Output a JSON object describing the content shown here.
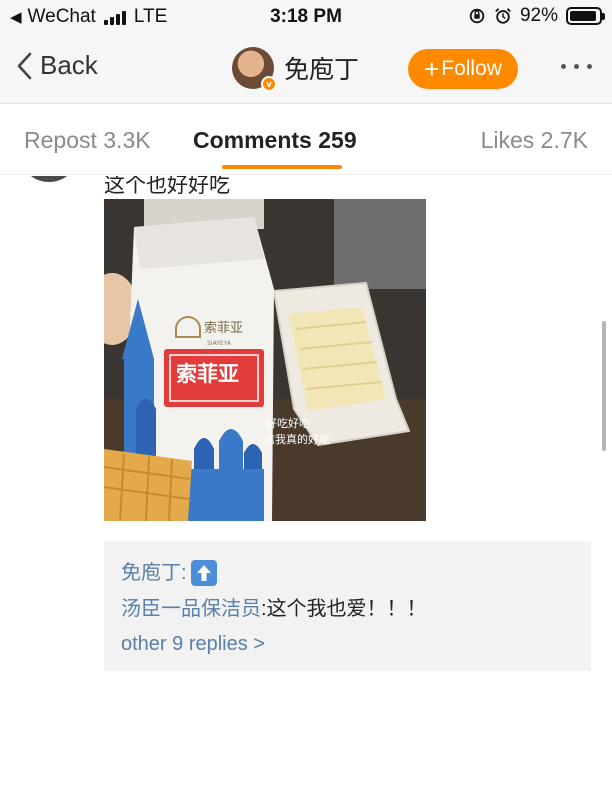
{
  "status_bar": {
    "carrier": "WeChat",
    "network": "LTE",
    "time": "3:18 PM",
    "battery": "92%",
    "battery_level": 0.92
  },
  "nav": {
    "back_label": "Back",
    "username": "免庖丁",
    "follow_label": "Follow",
    "verified_badge": "v"
  },
  "tabs": {
    "repost": "Repost 3.3K",
    "comments": "Comments 259",
    "likes": "Likes 2.7K"
  },
  "comment": {
    "text": "这个也好好吃",
    "image": {
      "brand_cn": "索菲亚",
      "brand_small": "索菲亚",
      "brand_latin": "SIAYEYA",
      "caption_line1": "好吃好吃",
      "caption_line2": "信我真的好吃"
    }
  },
  "replies": {
    "items": [
      {
        "user": "免庖丁",
        "sep": ":",
        "text": "",
        "emoji": "up-arrow-emoji"
      },
      {
        "user": "汤臣一品保洁员",
        "sep": ":",
        "text": " 这个我也爱！！！"
      }
    ],
    "more_label": "other 9 replies >"
  },
  "colors": {
    "accent": "#ff8a00",
    "link": "#5a7fa8",
    "reply_bg": "#f2f2f2"
  }
}
